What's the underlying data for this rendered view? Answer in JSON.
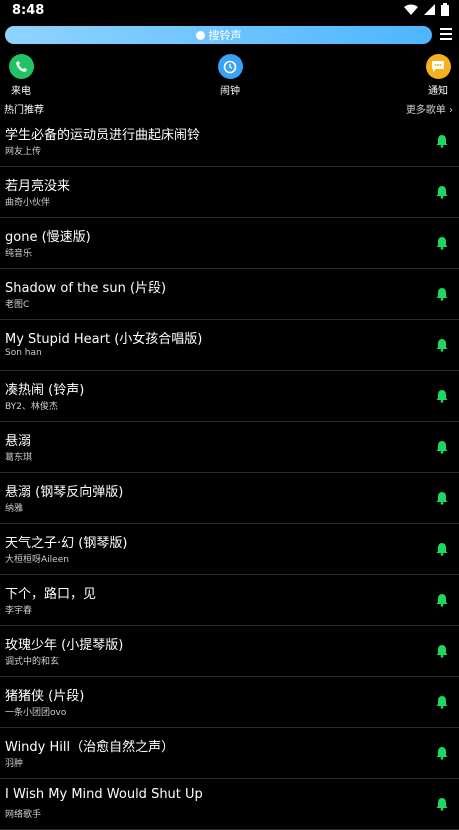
{
  "status": {
    "time": "8:48"
  },
  "search": {
    "label": "搜铃声"
  },
  "quick_actions": [
    {
      "label": "来电",
      "color": "#21c465",
      "icon": "phone-icon"
    },
    {
      "label": "闹钟",
      "color": "#3aa3f5",
      "icon": "alarm-clock-icon"
    },
    {
      "label": "通知",
      "color": "#f5b21e",
      "icon": "message-icon"
    }
  ],
  "section": {
    "title": "热门推荐",
    "more": "更多歌单 ›"
  },
  "accent": "#1ed760",
  "songs": [
    {
      "title": "学生必备的运动员进行曲起床闹铃",
      "artist": "网友上传"
    },
    {
      "title": "若月亮没来",
      "artist": "曲奇小伙伴"
    },
    {
      "title": "gone (慢速版)",
      "artist": "纯音乐"
    },
    {
      "title": "Shadow of the sun (片段)",
      "artist": "老图C"
    },
    {
      "title": "My Stupid Heart (小女孩合唱版)",
      "artist": "Son han"
    },
    {
      "title": "凑热闹 (铃声)",
      "artist": "BY2、林俊杰"
    },
    {
      "title": "悬溺",
      "artist": "葛东琪"
    },
    {
      "title": "悬溺 (钢琴反向弹版)",
      "artist": "纳雅"
    },
    {
      "title": "天气之子·幻 (钢琴版)",
      "artist": "大桓桓呀Aileen"
    },
    {
      "title": "下个，路口，见",
      "artist": "李宇春"
    },
    {
      "title": "玫瑰少年 (小提琴版)",
      "artist": "调式中的和玄"
    },
    {
      "title": "猪猪侠 (片段)",
      "artist": "一条小团团ovo"
    },
    {
      "title": "Windy Hill（治愈自然之声）",
      "artist": "羽肿"
    },
    {
      "title": "I Wish My Mind Would Shut Up",
      "artist": "网络歌手"
    }
  ]
}
